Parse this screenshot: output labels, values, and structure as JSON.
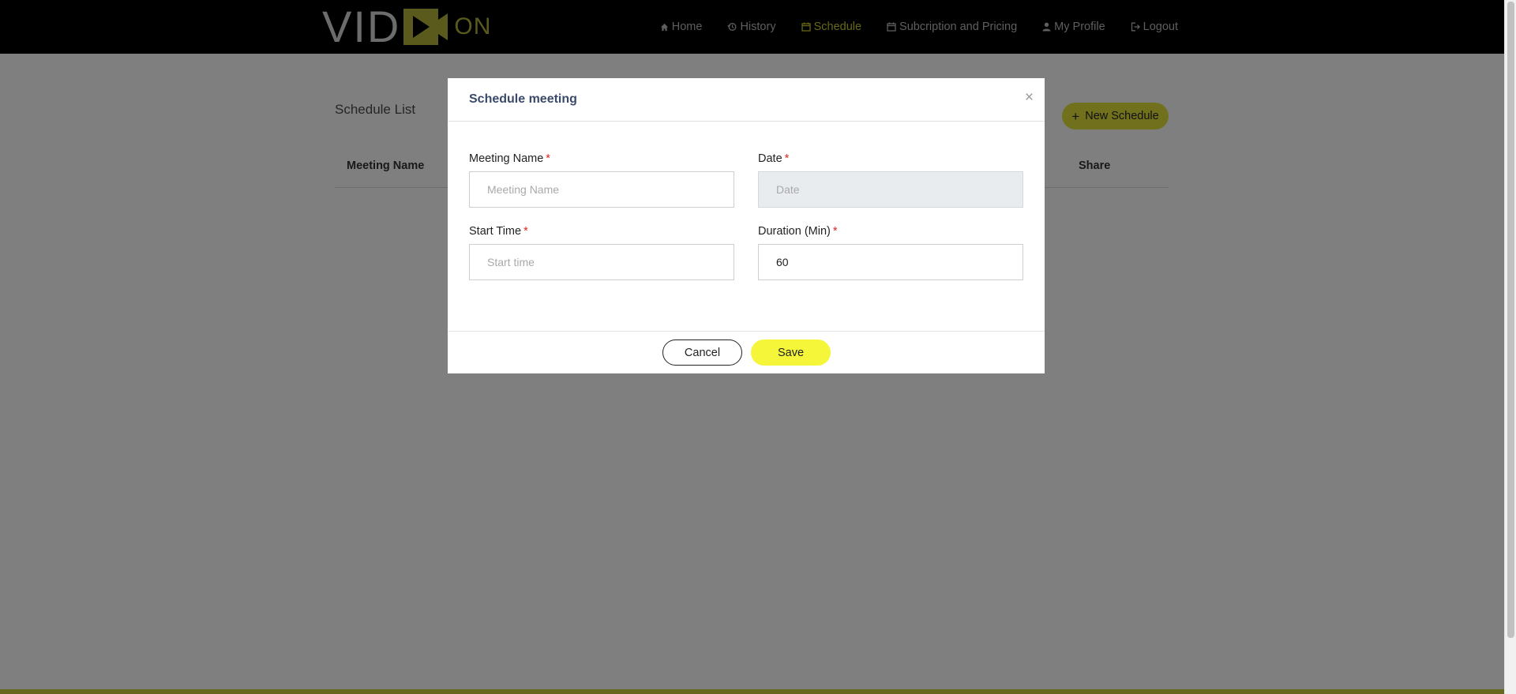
{
  "app": {
    "logo_left": "VID",
    "logo_right": "ON",
    "colors": {
      "accent": "#e2e23a",
      "nav_active": "#cfcf2a",
      "required": "#e0281f",
      "header_bg": "#000000"
    }
  },
  "nav": {
    "items": [
      {
        "label": "Home",
        "icon": "home-icon"
      },
      {
        "label": "History",
        "icon": "history-icon"
      },
      {
        "label": "Schedule",
        "icon": "calendar-icon",
        "active": true
      },
      {
        "label": "Subcription and Pricing",
        "icon": "calendar-icon"
      },
      {
        "label": "My Profile",
        "icon": "user-icon"
      },
      {
        "label": "Logout",
        "icon": "logout-icon"
      }
    ]
  },
  "page": {
    "title": "Schedule List",
    "new_button": "New Schedule",
    "columns": [
      "Meeting Name",
      "Share"
    ]
  },
  "modal": {
    "title": "Schedule meeting",
    "close": "×",
    "fields": {
      "meeting_name": {
        "label": "Meeting Name",
        "placeholder": "Meeting Name",
        "value": ""
      },
      "date": {
        "label": "Date",
        "placeholder": "Date",
        "value": ""
      },
      "start_time": {
        "label": "Start Time",
        "placeholder": "Start time",
        "value": ""
      },
      "duration": {
        "label": "Duration (Min)",
        "placeholder": "",
        "value": "60"
      }
    },
    "required_mark": "*",
    "cancel": "Cancel",
    "save": "Save"
  }
}
